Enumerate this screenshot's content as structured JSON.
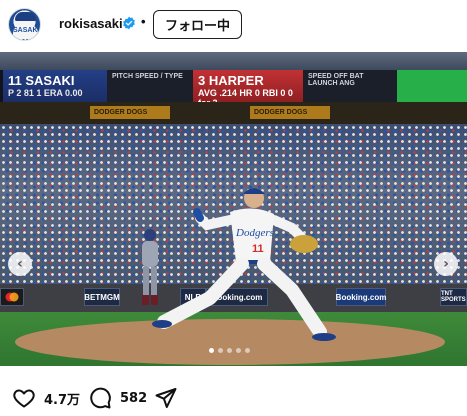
{
  "header": {
    "username": "rokisasaki",
    "avatar_text": "SASAKI 11",
    "verified_icon": "verified-badge-icon",
    "separator": "•",
    "follow_label": "フォロー中"
  },
  "photo": {
    "scoreboard": {
      "batter_name": "11 SASAKI",
      "batter_line": "P 2 81 1 ERA 0.00",
      "pitch_label": "PITCH SPEED / TYPE",
      "opponent_name": "3 HARPER",
      "opponent_line": "AVG .214 HR 0 RBI 0 0 for 3",
      "speed_label": "SPEED OFF BAT",
      "launch_label": "LAUNCH ANG"
    },
    "ad_text": "DODGER DOGS",
    "wall_ads": [
      "BETMGM",
      "NLB",
      "Booking.com",
      "Booking.com",
      "TNT SPORTS"
    ],
    "jersey_text": "Dodgers",
    "jersey_number": "11",
    "carousel": {
      "total": 5,
      "active_index": 0
    },
    "accent_blue": "#2b5bb5",
    "field_green": "#3f8a3a"
  },
  "actions": {
    "like_icon": "heart-icon",
    "like_count": "4.7万",
    "comment_icon": "comment-icon",
    "comment_count": "582",
    "share_icon": "send-icon"
  }
}
